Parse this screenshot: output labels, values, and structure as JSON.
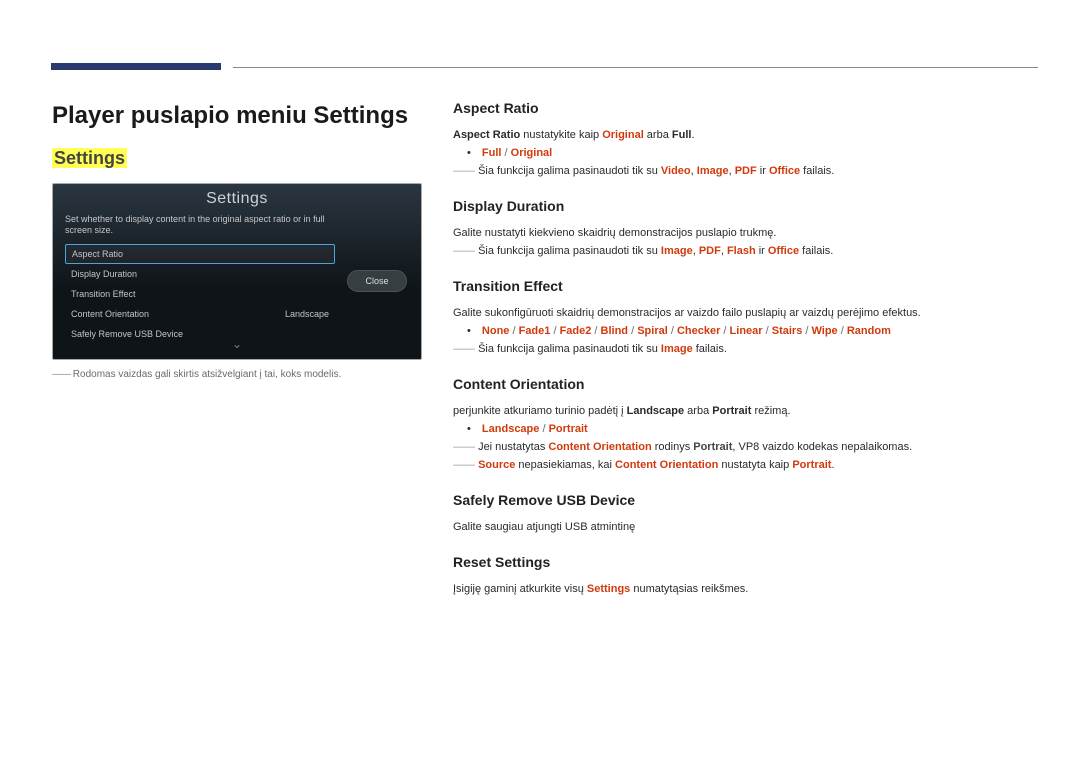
{
  "header": {
    "page_title": "Player puslapio meniu Settings",
    "highlighted_label": "Settings"
  },
  "screenshot": {
    "window_title": "Settings",
    "description_line1": "Set whether to display content in the original aspect ratio or in full",
    "description_line2": "screen size.",
    "close": "Close",
    "items": {
      "aspect_ratio": "Aspect Ratio",
      "display_duration": "Display Duration",
      "transition_effect": "Transition Effect",
      "content_orientation": "Content Orientation",
      "content_orientation_value": "Landscape",
      "safely_remove": "Safely Remove USB Device"
    }
  },
  "left_note": "Rodomas vaizdas gali skirtis atsižvelgiant į tai, koks modelis.",
  "sections": {
    "aspect_ratio": {
      "title": "Aspect Ratio",
      "p1_pre": "Aspect Ratio",
      "p1_mid": " nustatykite kaip ",
      "p1_val1": "Original",
      "p1_or": " arba ",
      "p1_val2": "Full",
      "p1_end": ".",
      "opt_full": "Full",
      "opt_original": "Original",
      "opt_sep": " / ",
      "note_pre": "Šia funkcija galima pasinaudoti tik su ",
      "note_v": "Video",
      "note_i": "Image",
      "note_p": "PDF",
      "note_o": "Office",
      "note_sep": ", ",
      "note_and": " ir ",
      "note_suf": " failais."
    },
    "display_duration": {
      "title": "Display Duration",
      "p1": "Galite nustatyti kiekvieno skaidrių demonstracijos puslapio trukmę.",
      "note_pre": "Šia funkcija galima pasinaudoti tik su ",
      "note_i": "Image",
      "note_p": "PDF",
      "note_f": "Flash",
      "note_o": "Office",
      "note_sep": ", ",
      "note_and": " ir ",
      "note_suf": " failais."
    },
    "transition_effect": {
      "title": "Transition Effect",
      "p1": "Galite sukonfigūruoti skaidrių demonstracijos ar vaizdo failo puslapių ar vaizdų perėjimo efektus.",
      "opt_none": "None",
      "opt_fade1": "Fade1",
      "opt_fade2": "Fade2",
      "opt_blind": "Blind",
      "opt_spiral": "Spiral",
      "opt_checker": "Checker",
      "opt_linear": "Linear",
      "opt_stairs": "Stairs",
      "opt_wipe": "Wipe",
      "opt_random": "Random",
      "opt_sep": " / ",
      "note_pre": "Šia funkcija galima pasinaudoti tik su ",
      "note_i": "Image",
      "note_suf": " failais."
    },
    "content_orientation": {
      "title": "Content Orientation",
      "p1_pre": "perjunkite atkuriamo turinio padėtį į ",
      "p1_land": "Landscape",
      "p1_or": " arba ",
      "p1_port": "Portrait",
      "p1_suf": " režimą.",
      "opt_land": "Landscape",
      "opt_port": "Portrait",
      "opt_sep": " / ",
      "note1_pre": "Jei nustatytas ",
      "note1_co": "Content Orientation",
      "note1_mid": " rodinys ",
      "note1_port": "Portrait",
      "note1_suf": ", VP8 vaizdo kodekas nepalaikomas.",
      "note2_src": "Source",
      "note2_mid": " nepasiekiamas, kai ",
      "note2_co": "Content Orientation",
      "note2_mid2": " nustatyta kaip ",
      "note2_port": "Portrait",
      "note2_end": "."
    },
    "safely_remove": {
      "title": "Safely Remove USB Device",
      "p1": "Galite saugiau atjungti USB atmintinę"
    },
    "reset_settings": {
      "title": "Reset Settings",
      "p1_pre": "Įsigiję gaminį atkurkite visų ",
      "p1_kw": "Settings",
      "p1_suf": " numatytąsias reikšmes."
    }
  }
}
